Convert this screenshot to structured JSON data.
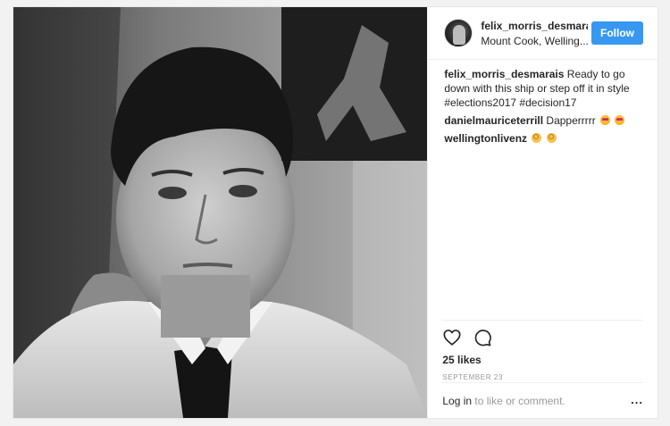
{
  "post": {
    "username": "felix_morris_desmarais",
    "location": "Mount Cook, Welling...",
    "follow_label": "Follow",
    "caption": {
      "username": "felix_morris_desmarais",
      "text": "Ready to go down with this ship or step off it in style #elections2017 #decision17"
    },
    "comments": [
      {
        "username": "danielmauriceterrill",
        "text": "Dapperrrrr",
        "emoji": [
          "heart-eyes-emoji",
          "heart-eyes-emoji"
        ]
      },
      {
        "username": "wellingtonlivenz",
        "text": "",
        "emoji": [
          "ok-hand-emoji",
          "ok-hand-emoji"
        ]
      }
    ],
    "likes": "25 likes",
    "date": "SEPTEMBER 23",
    "login_link": "Log in",
    "login_suffix": " to like or comment.",
    "more_label": "..."
  },
  "colors": {
    "accent": "#3897f0",
    "muted": "#999999",
    "text": "#262626"
  },
  "icons": {
    "like": "heart-outline-icon",
    "comment": "comment-bubble-icon"
  }
}
